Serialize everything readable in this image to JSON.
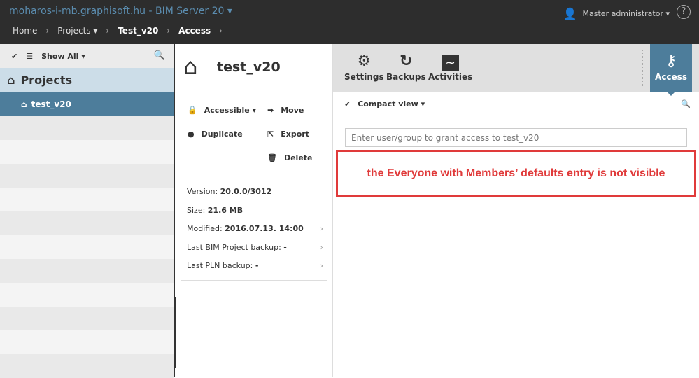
{
  "header": {
    "title": "moharos-i-mb.graphisoft.hu - BIM Server 20 ▾",
    "user": "Master administrator ▾",
    "help": "?",
    "breadcrumb": [
      "Home",
      "Projects ▾",
      "Test_v20",
      "Access"
    ]
  },
  "sidebar": {
    "show_all": "Show All ▾",
    "projects": "Projects",
    "selected": "test_v20"
  },
  "project": {
    "name": "test_v20",
    "actions": {
      "accessible": "Accessible ▾",
      "move": "Move",
      "duplicate": "Duplicate",
      "export": "Export",
      "delete": "Delete"
    },
    "info": [
      {
        "label": "Version: ",
        "value": "20.0.0/3012"
      },
      {
        "label": "Size: ",
        "value": "21.6 MB"
      },
      {
        "label": "Modified: ",
        "value": "2016.07.13. 14:00"
      },
      {
        "label": "Last BIM Project backup: ",
        "value": "-"
      },
      {
        "label": "Last PLN backup: ",
        "value": "-"
      }
    ]
  },
  "toolbar": {
    "settings": "Settings",
    "backups": "Backups",
    "activities": "Activities",
    "access": "Access"
  },
  "access": {
    "view": "Compact view ▾",
    "placeholder": "Enter user/group to grant access to test_v20",
    "note": "the Everyone with Members’ defaults entry is not visible"
  }
}
